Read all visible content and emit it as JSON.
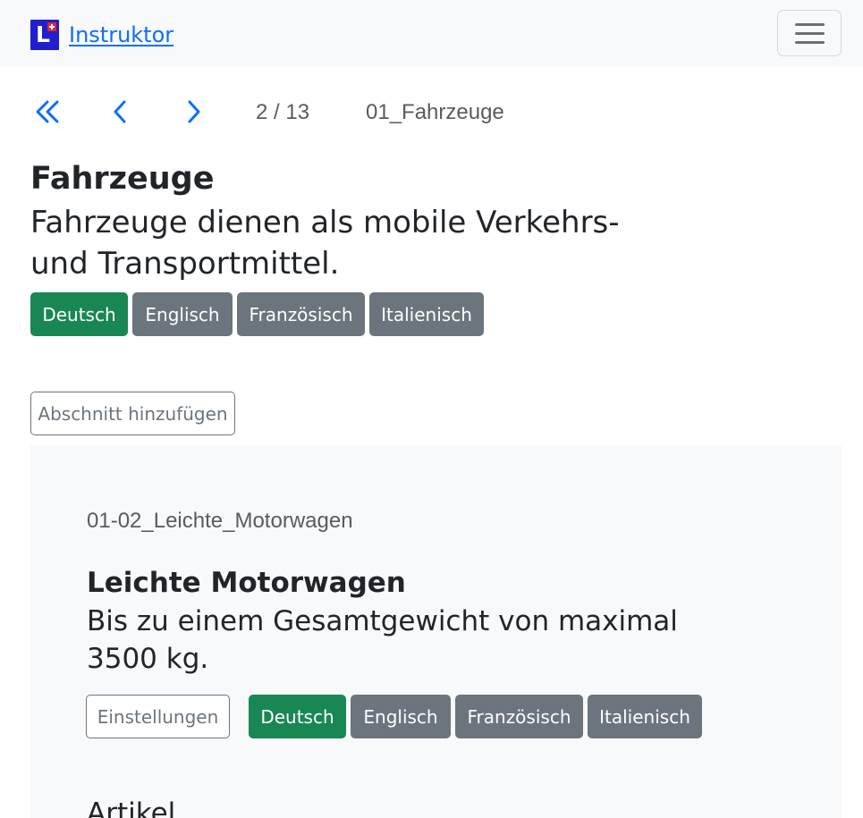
{
  "navbar": {
    "brand_text": "Instruktor",
    "logo_letter": "L",
    "accent_color": "#0d6efd"
  },
  "pager": {
    "position": "2 / 13",
    "chapter_code": "01_Fahrzeuge"
  },
  "chapter": {
    "title": "Fahrzeuge",
    "subtitle": "Fahrzeuge dienen als mobile Verkehrs- und Transportmittel.",
    "languages": [
      "Deutsch",
      "Englisch",
      "Französisch",
      "Italienisch"
    ],
    "active_language": "Deutsch"
  },
  "add_section_label": "Abschnitt hinzufügen",
  "section": {
    "code": "01-02_Leichte_Motorwagen",
    "title": "Leichte Motorwagen",
    "subtitle": "Bis zu einem Gesamtgewicht von maximal 3500 kg.",
    "settings_label": "Einstellungen",
    "languages": [
      "Deutsch",
      "Englisch",
      "Französisch",
      "Italienisch"
    ],
    "active_language": "Deutsch",
    "articles_heading": "Artikel"
  },
  "colors": {
    "success": "#198754",
    "secondary": "#6c757d",
    "card_bg": "#f8f9fa"
  }
}
